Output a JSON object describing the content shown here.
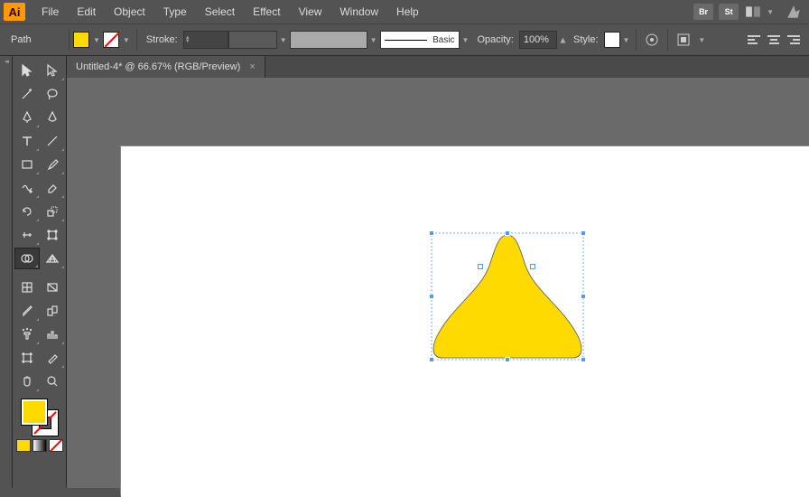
{
  "app": {
    "logo": "Ai"
  },
  "menu": {
    "file": "File",
    "edit": "Edit",
    "object": "Object",
    "type": "Type",
    "select": "Select",
    "effect": "Effect",
    "view": "View",
    "window": "Window",
    "help": "Help"
  },
  "header_icons": {
    "bridge": "Br",
    "stock": "St"
  },
  "controlbar": {
    "selection": "Path",
    "stroke_label": "Stroke:",
    "brush_profile": "Basic",
    "opacity_label": "Opacity:",
    "opacity_value": "100%",
    "style_label": "Style:"
  },
  "document": {
    "tab_title": "Untitled-4* @ 66.67% (RGB/Preview)"
  },
  "colors": {
    "fill": "#FFDA00",
    "stroke": "none"
  }
}
